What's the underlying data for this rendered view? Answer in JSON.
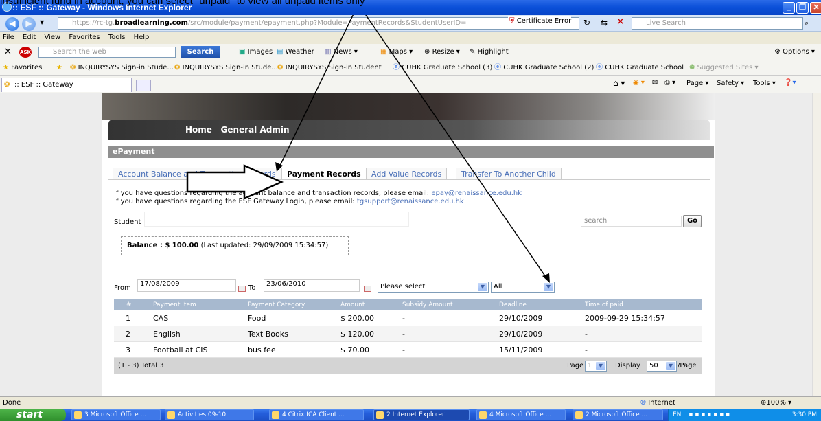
{
  "caption": "insufficient fund in account, you can select \"unpaid\" to view all unpaid items only",
  "window": {
    "title": ":: ESF :: Gateway - Windows Internet Explorer"
  },
  "address": {
    "prefix": "https://rc-tg.",
    "host": "broadlearning.com",
    "path": "/src/module/payment/epayment.php?Module=PaymentRecords&StudentUserID=",
    "cert_error": "Certificate Error",
    "live_search": "Live Search"
  },
  "menu": [
    "File",
    "Edit",
    "View",
    "Favorites",
    "Tools",
    "Help"
  ],
  "toolbar": {
    "search_placeholder": "Search the web",
    "search_btn": "Search",
    "images": "Images",
    "weather": "Weather",
    "news": "News",
    "maps": "Maps",
    "resize": "Resize",
    "highlight": "Highlight",
    "options": "Options"
  },
  "favorites": {
    "label": "Favorites",
    "items": [
      "INQUIRYSYS Sign-in Stude...",
      "INQUIRYSYS Sign-in Stude...",
      "INQUIRYSYS Sign-in Student",
      "CUHK Graduate School (3)",
      "CUHK Graduate School (2)",
      "CUHK Graduate School",
      "Suggested Sites"
    ]
  },
  "tab": {
    "label": ":: ESF :: Gateway"
  },
  "cmdbar": {
    "page": "Page",
    "safety": "Safety",
    "tools": "Tools"
  },
  "site": {
    "nav": {
      "home": "Home",
      "admin": "General Admin"
    },
    "panel_title": "ePayment",
    "tabs": [
      "Account Balance and Transaction Records",
      "Payment Records",
      "Add Value Records",
      "Transfer To Another Child"
    ],
    "info1_pre": "If you have questions regarding the account balance and transaction records, please email: ",
    "info1_link": "epay@renaissance.edu.hk",
    "info2_pre": "If you have questions regarding the ESF Gateway Login, please email: ",
    "info2_link": "tgsupport@renaissance.edu.hk",
    "student_label": "Student",
    "search_placeholder": "search",
    "go": "Go",
    "balance": "Balance : $ 100.00",
    "balance_updated": "(Last updated: 29/09/2009 15:34:57)",
    "from_label": "From",
    "from_date": "17/08/2009",
    "to_label": "To",
    "to_date": "23/06/2010",
    "category_select": "Please select",
    "status_select": "All",
    "columns": [
      "#",
      "Payment Item",
      "Payment Category",
      "Amount",
      "Subsidy Amount",
      "Deadline",
      "Time of paid"
    ],
    "rows": [
      [
        "1",
        "CAS",
        "Food",
        "$ 200.00",
        "-",
        "29/10/2009",
        "2009-09-29 15:34:57"
      ],
      [
        "2",
        "English",
        "Text Books",
        "$ 120.00",
        "-",
        "29/10/2009",
        "-"
      ],
      [
        "3",
        "Football at CIS",
        "bus fee",
        "$ 70.00",
        "-",
        "15/11/2009",
        "-"
      ]
    ],
    "total": "(1 - 3) Total 3",
    "page_label": "Page",
    "page_value": "1",
    "display_label": "Display",
    "display_value": "50",
    "per_page": "/Page"
  },
  "status": {
    "left": "Done",
    "zone": "Internet",
    "zoom": "100%"
  },
  "taskbar": {
    "start": "start",
    "items": [
      "3 Microsoft Office ...",
      "Activities 09-10",
      "4 Citrix ICA Client ...",
      "2 Internet Explorer",
      "4 Microsoft Office ...",
      "2 Microsoft Office ..."
    ],
    "lang": "EN",
    "clock": "3:30 PM"
  }
}
